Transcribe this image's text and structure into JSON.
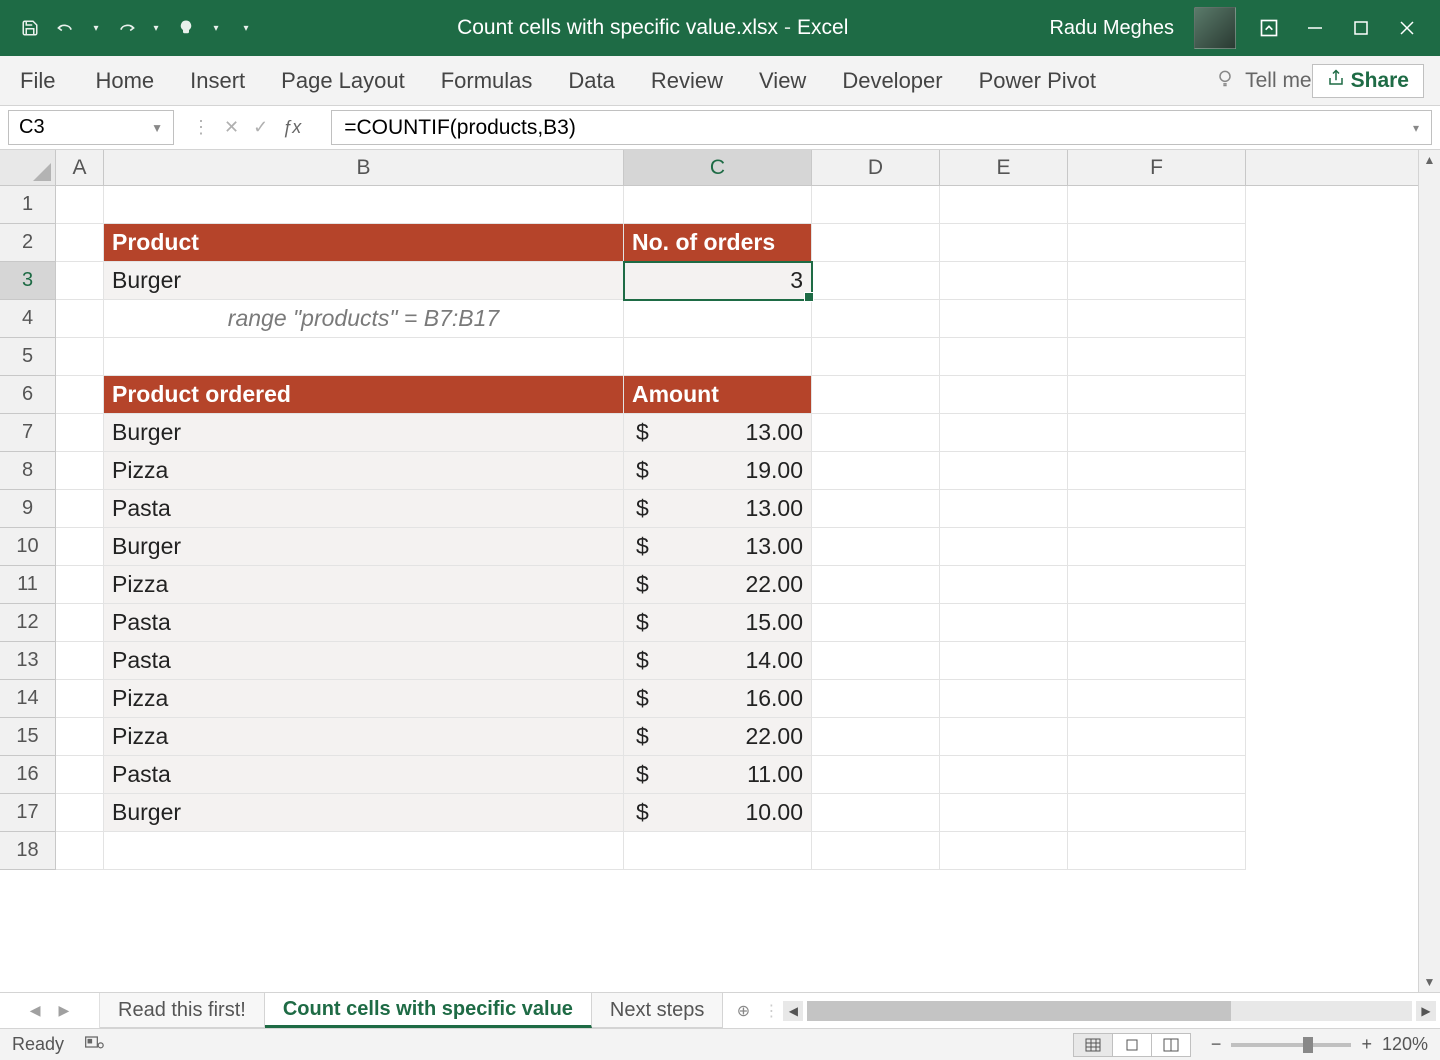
{
  "title": {
    "file": "Count cells with specific value.xlsx",
    "app": "Excel"
  },
  "user": "Radu Meghes",
  "ribbon": [
    "File",
    "Home",
    "Insert",
    "Page Layout",
    "Formulas",
    "Data",
    "Review",
    "View",
    "Developer",
    "Power Pivot"
  ],
  "tellme": "Tell me",
  "share": "Share",
  "namebox": "C3",
  "formula": "=COUNTIF(products,B3)",
  "columns": [
    "A",
    "B",
    "C",
    "D",
    "E",
    "F"
  ],
  "rows": [
    "1",
    "2",
    "3",
    "4",
    "5",
    "6",
    "7",
    "8",
    "9",
    "10",
    "11",
    "12",
    "13",
    "14",
    "15",
    "16",
    "17",
    "18"
  ],
  "active_col": "C",
  "active_row": "3",
  "cells": {
    "B2": "Product",
    "C2": "No. of orders",
    "B3": "Burger",
    "C3": "3",
    "B4": "range \"products\" = B7:B17",
    "B6": "Product ordered",
    "C6": "Amount",
    "products": [
      {
        "row": "7",
        "name": "Burger",
        "amt": "13.00"
      },
      {
        "row": "8",
        "name": "Pizza",
        "amt": "19.00"
      },
      {
        "row": "9",
        "name": "Pasta",
        "amt": "13.00"
      },
      {
        "row": "10",
        "name": "Burger",
        "amt": "13.00"
      },
      {
        "row": "11",
        "name": "Pizza",
        "amt": "22.00"
      },
      {
        "row": "12",
        "name": "Pasta",
        "amt": "15.00"
      },
      {
        "row": "13",
        "name": "Pasta",
        "amt": "14.00"
      },
      {
        "row": "14",
        "name": "Pizza",
        "amt": "16.00"
      },
      {
        "row": "15",
        "name": "Pizza",
        "amt": "22.00"
      },
      {
        "row": "16",
        "name": "Pasta",
        "amt": "11.00"
      },
      {
        "row": "17",
        "name": "Burger",
        "amt": "10.00"
      }
    ]
  },
  "currency": "$",
  "sheets": [
    {
      "name": "Read this first!",
      "active": false
    },
    {
      "name": "Count cells with specific value",
      "active": true
    },
    {
      "name": "Next steps",
      "active": false
    }
  ],
  "status": "Ready",
  "zoom": "120%"
}
